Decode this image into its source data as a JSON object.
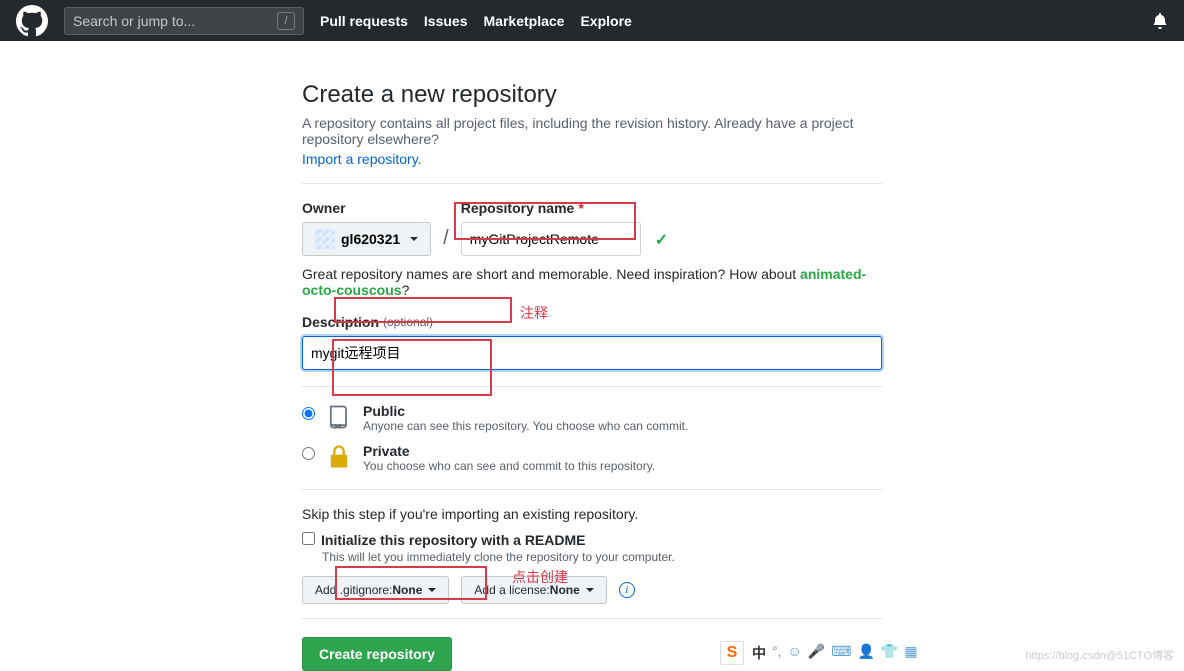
{
  "header": {
    "search_placeholder": "Search or jump to...",
    "nav": [
      "Pull requests",
      "Issues",
      "Marketplace",
      "Explore"
    ]
  },
  "page": {
    "title": "Create a new repository",
    "subhead": "A repository contains all project files, including the revision history. Already have a project repository elsewhere?",
    "import_link": "Import a repository."
  },
  "form": {
    "owner_label": "Owner",
    "owner_value": "gl620321",
    "repo_label": "Repository name",
    "repo_value": "myGitProjectRemote",
    "tip_prefix": "Great repository names are short and memorable. Need inspiration? How about ",
    "tip_suggest": "animated-octo-couscous",
    "tip_suffix": "?",
    "desc_label": "Description",
    "desc_optional": "(optional)",
    "desc_value": "mygit远程项目",
    "visibility": {
      "public": {
        "label": "Public",
        "sub": "Anyone can see this repository. You choose who can commit."
      },
      "private": {
        "label": "Private",
        "sub": "You choose who can see and commit to this repository."
      }
    },
    "skip_text": "Skip this step if you're importing an existing repository.",
    "readme_label": "Initialize this repository with a README",
    "readme_sub": "This will let you immediately clone the repository to your computer.",
    "gitignore_prefix": "Add .gitignore: ",
    "gitignore_value": "None",
    "license_prefix": "Add a license: ",
    "license_value": "None",
    "create_btn": "Create repository"
  },
  "annotations": {
    "desc_note": "注释",
    "create_note": "点击创建"
  },
  "ime": {
    "lang": "中"
  },
  "watermark": "https://blog.csdn@51CTO博客"
}
